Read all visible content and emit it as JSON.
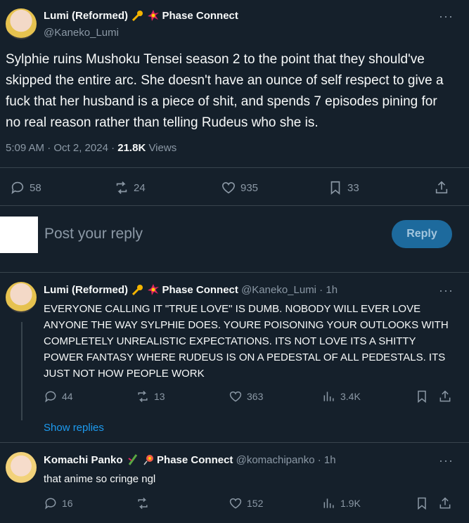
{
  "main_tweet": {
    "display_name": "Lumi (Reformed)",
    "affiliation": "Phase Connect",
    "handle": "@Kaneko_Lumi",
    "text": "Sylphie ruins Mushoku Tensei season 2 to the point that they should've skipped the entire arc. She doesn't have an ounce of self respect to give a fuck that her husband is a piece of shit, and spends 7 episodes pining for no real reason rather than telling Rudeus who she is.",
    "timestamp": "5:09 AM · Oct 2, 2024 · ",
    "views_count": "21.8K",
    "views_label": " Views",
    "replies": "58",
    "reposts": "24",
    "likes": "935",
    "bookmarks": "33"
  },
  "compose": {
    "placeholder": "Post your reply",
    "button": "Reply"
  },
  "replies": [
    {
      "display_name": "Lumi (Reformed)",
      "affiliation": "Phase Connect",
      "meta": "@Kaneko_Lumi · 1h",
      "text": "EVERYONE CALLING IT \"TRUE LOVE\" IS DUMB. NOBODY WILL EVER LOVE ANYONE THE WAY SYLPHIE DOES. YOURE POISONING YOUR OUTLOOKS WITH COMPLETELY UNREALISTIC EXPECTATIONS. ITS NOT LOVE ITS A SHITTY POWER FANTASY WHERE RUDEUS IS ON A PEDESTAL OF ALL PEDESTALS. ITS JUST NOT HOW PEOPLE WORK",
      "replies": "44",
      "reposts": "13",
      "likes": "363",
      "views": "3.4K",
      "show_replies": "Show replies"
    },
    {
      "display_name": "Komachi Panko",
      "affiliation": "Phase Connect",
      "meta": "@komachipanko · 1h",
      "text": "that anime so cringe ngl",
      "replies": "16",
      "reposts": "",
      "likes": "152",
      "views": "1.9K"
    }
  ],
  "colors": {
    "background": "#15202b",
    "text": "#f7f9f9",
    "muted": "#8b98a5",
    "accent": "#1d9bf0",
    "divider": "#38444d"
  },
  "icons": [
    "reply-icon",
    "repost-icon",
    "like-icon",
    "bookmark-icon",
    "share-icon",
    "views-icon",
    "more-icon"
  ]
}
